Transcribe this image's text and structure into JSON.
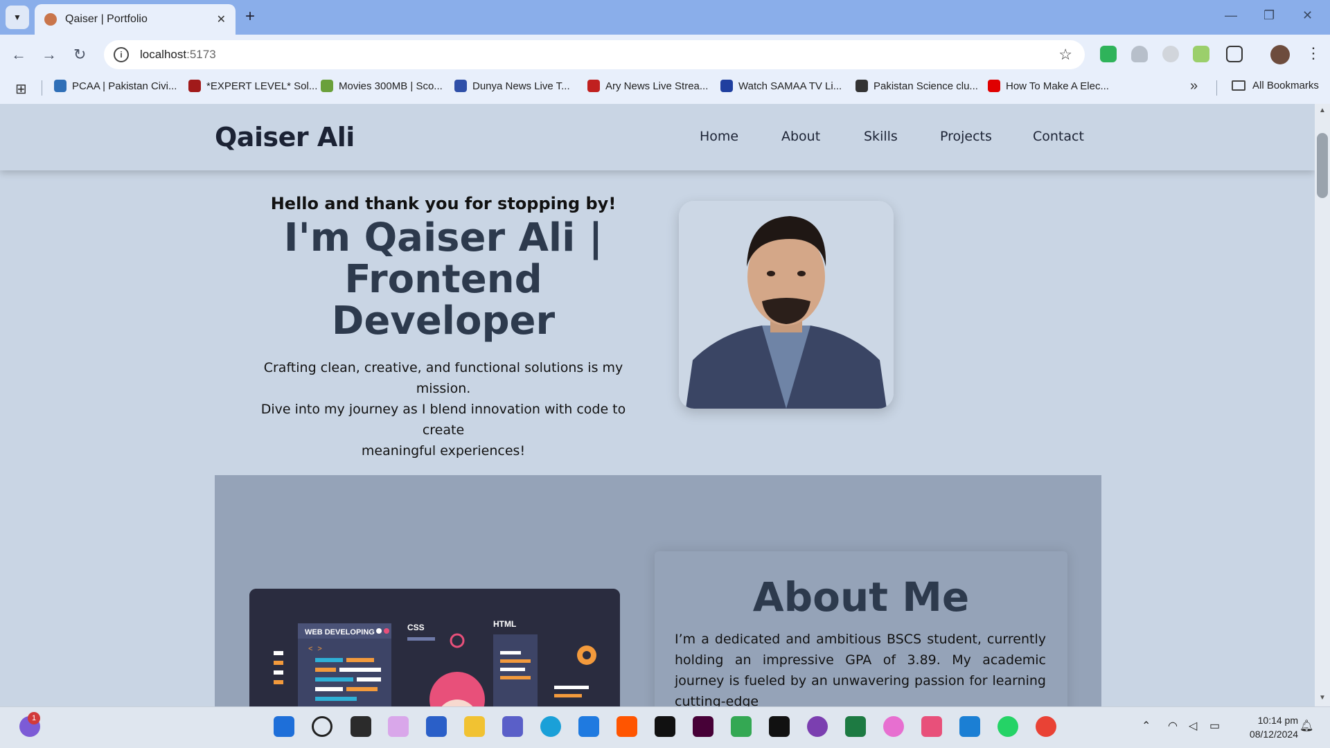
{
  "browser": {
    "tab_title": "Qaiser | Portfolio",
    "tab_close": "✕",
    "new_tab": "+",
    "url_host": "localhost",
    "url_port": ":5173",
    "win_minimize": "—",
    "win_restore": "❐",
    "win_close": "✕"
  },
  "bookmarks": {
    "items": [
      {
        "label": "PCAA | Pakistan Civi...",
        "color": "#2f6fb7"
      },
      {
        "label": "*EXPERT LEVEL* Sol...",
        "color": "#a11a1a"
      },
      {
        "label": "Movies 300MB | Sco...",
        "color": "#6aa03a"
      },
      {
        "label": "Dunya News Live T...",
        "color": "#2f4fa8"
      },
      {
        "label": "Ary News Live Strea...",
        "color": "#c0201f"
      },
      {
        "label": "Watch SAMAA TV Li...",
        "color": "#1f3f9f"
      },
      {
        "label": "Pakistan Science clu...",
        "color": "#333333"
      },
      {
        "label": "How To Make A Elec...",
        "color": "#e00000"
      }
    ],
    "more": "»",
    "all_label": "All Bookmarks"
  },
  "site": {
    "logo": "Qaiser Ali",
    "nav": [
      "Home",
      "About",
      "Skills",
      "Projects",
      "Contact"
    ],
    "hero": {
      "greeting": "Hello and thank you for stopping by!",
      "title_line1": "I'm Qaiser Ali |",
      "title_line2": "Frontend",
      "title_line3": "Developer",
      "desc_line1": "Crafting clean, creative, and functional solutions is my mission.",
      "desc_line2": "Dive into my journey as I blend innovation with code to create",
      "desc_line3": "meaningful experiences!"
    },
    "about": {
      "title": "About Me",
      "text": "I’m a dedicated and ambitious BSCS student, currently holding an impressive GPA of 3.89. My academic journey is fueled by an unwavering passion for learning cutting-edge",
      "illustration": {
        "web_developing": "WEB DEVELOPING",
        "css": "CSS",
        "html": "HTML",
        "code_tag": "< >"
      }
    }
  },
  "taskbar": {
    "badge": "1",
    "time": "10:14 pm",
    "date": "08/12/2024"
  },
  "colors": {
    "accent_tabbar": "#8aaeea",
    "page_bg": "#c9d5e4",
    "about_bg": "#95a3b8",
    "heading": "#2d3a4d"
  }
}
